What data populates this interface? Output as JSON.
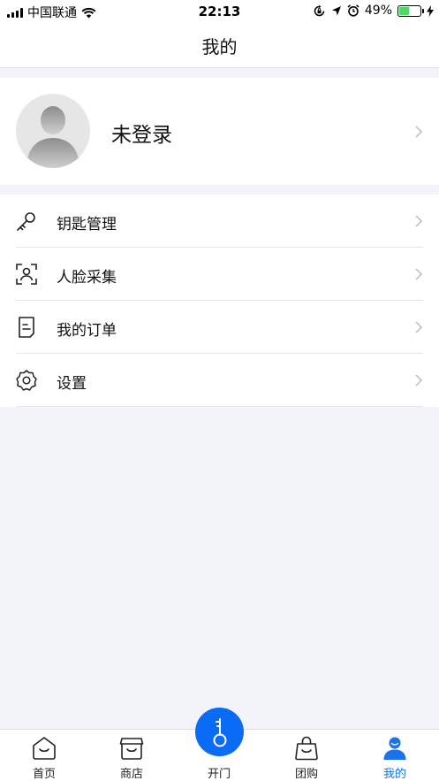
{
  "status_bar": {
    "carrier": "中国联通",
    "time": "22:13",
    "battery_percent": "49%",
    "battery_level": 0.49
  },
  "navbar": {
    "title": "我的"
  },
  "profile": {
    "name": "未登录"
  },
  "menu": {
    "items": [
      {
        "label": "钥匙管理",
        "icon": "key-icon"
      },
      {
        "label": "人脸采集",
        "icon": "face-scan-icon"
      },
      {
        "label": "我的订单",
        "icon": "order-icon"
      },
      {
        "label": "设置",
        "icon": "settings-icon"
      }
    ]
  },
  "tabbar": {
    "tabs": [
      {
        "label": "首页",
        "icon": "home-icon"
      },
      {
        "label": "商店",
        "icon": "shop-icon"
      },
      {
        "label": "开门",
        "icon": "key-unlock-icon"
      },
      {
        "label": "团购",
        "icon": "group-buy-bag-icon"
      },
      {
        "label": "我的",
        "icon": "profile-icon"
      }
    ],
    "active_index": 4
  },
  "colors": {
    "accent": "#0a6cf4",
    "active_tab": "#1a73e8",
    "battery": "#4cd964",
    "background": "#f3f4f9"
  }
}
